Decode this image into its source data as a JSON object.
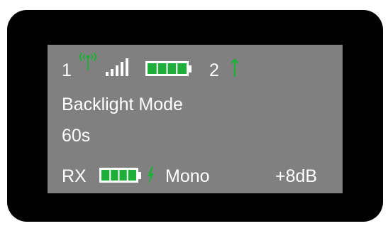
{
  "status_bar": {
    "channel_1": "1",
    "channel_2": "2",
    "icons": {
      "antenna": "antenna-signal-icon",
      "signal": "signal-bars-icon",
      "battery": "battery-full-icon",
      "channel_2_antenna": "antenna-icon"
    }
  },
  "menu": {
    "title": "Backlight Mode",
    "value": "60s"
  },
  "footer": {
    "rx_label": "RX",
    "mode": "Mono",
    "gain": "+8dB",
    "icons": {
      "battery": "battery-full-icon",
      "charging": "charging-bolt-icon"
    }
  },
  "colors": {
    "bezel": "#000000",
    "screen": "#808080",
    "text": "#ffffff",
    "accent_green": "#1fae3a"
  }
}
